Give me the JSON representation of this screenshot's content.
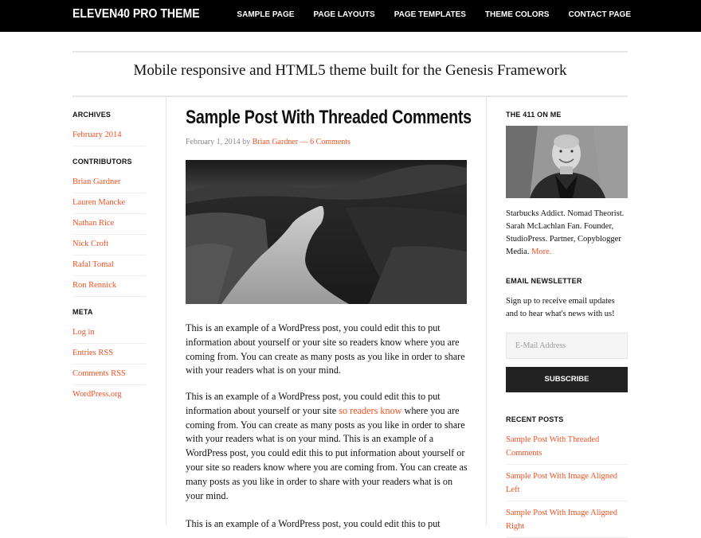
{
  "header": {
    "site_title": "ELEVEN40 PRO THEME",
    "nav": [
      "SAMPLE PAGE",
      "PAGE LAYOUTS",
      "PAGE TEMPLATES",
      "THEME COLORS",
      "CONTACT PAGE"
    ]
  },
  "tagline": "Mobile responsive and HTML5 theme built for the Genesis Framework",
  "left_sidebar": {
    "archives_title": "ARCHIVES",
    "archives": [
      "February 2014"
    ],
    "contributors_title": "CONTRIBUTORS",
    "contributors": [
      "Brian Gardner",
      "Lauren Mancke",
      "Nathan Rice",
      "Nick Croft",
      "Rafal Tomal",
      "Ron Rennick"
    ],
    "meta_title": "META",
    "meta": [
      "Log in",
      "Entries RSS",
      "Comments RSS",
      "WordPress.org"
    ]
  },
  "post": {
    "title": "Sample Post With Threaded Comments",
    "date": "February 1, 2014",
    "by": "by",
    "author": "Brian Gardner",
    "sep": "—",
    "comments": "6 Comments",
    "para1": "This is an example of a WordPress post, you could edit this to put information about yourself or your site so readers know where you are coming from. You can create as many posts as you like in order to share with your readers what is on your mind.",
    "para2_before": "This is an example of a WordPress post, you could edit this to put information about yourself or your site ",
    "para2_link": "so readers know",
    "para2_after": " where you are coming from. You can create as many posts as you like in order to share with your readers what is on your mind. This is an example of a WordPress post, you could edit this to put information about yourself or your site so readers know where you are coming from. You can create as many posts as you like in order to share with your readers what is on your mind.",
    "para3": "This is an example of a WordPress post, you could edit this to put"
  },
  "right_sidebar": {
    "about_title": "THE 411 ON ME",
    "bio": "Starbucks Addict. Nomad Theorist. Sarah McLachlan Fan. Founder, StudioPress. Partner, Copyblogger Media.",
    "bio_more": "More.",
    "newsletter_title": "EMAIL NEWSLETTER",
    "newsletter_text": "Sign up to receive email updates and to hear what's news with us!",
    "email_placeholder": "E-Mail Address",
    "subscribe_label": "SUBSCRIBE",
    "recent_title": "RECENT POSTS",
    "recent_posts": [
      "Sample Post With Threaded Comments",
      "Sample Post With Image Aligned Left",
      "Sample Post With Image Aligned Right"
    ]
  },
  "colors": {
    "accent": "#f15123",
    "header_bg": "#000000",
    "button_bg": "#222222"
  }
}
